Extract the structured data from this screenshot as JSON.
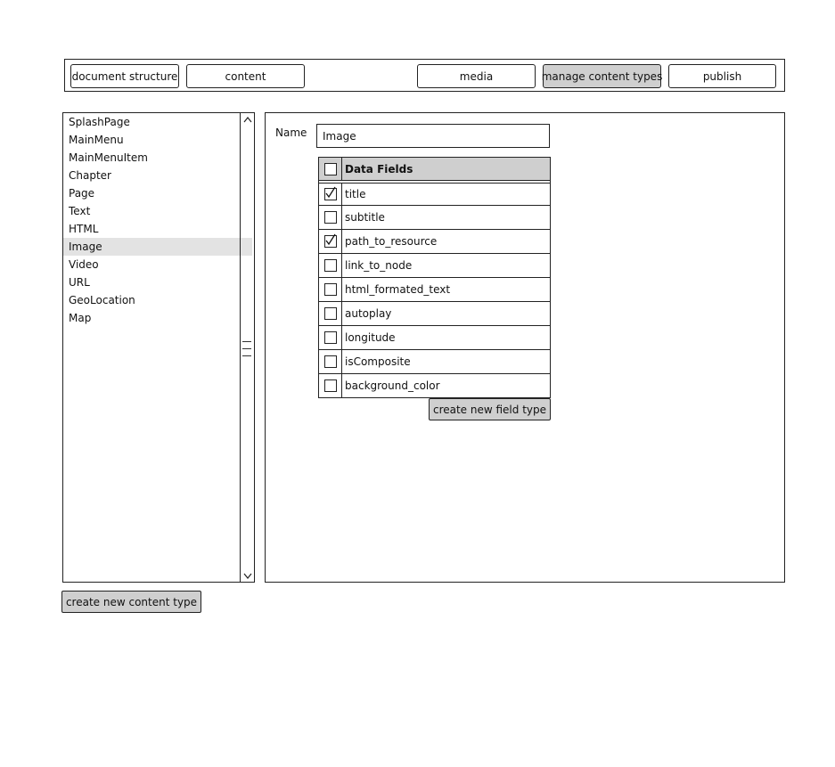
{
  "tabs": [
    {
      "label": "document structure",
      "active": false
    },
    {
      "label": "content",
      "active": false
    },
    {
      "label": "media",
      "active": false
    },
    {
      "label": "manage content types",
      "active": true
    },
    {
      "label": "publish",
      "active": false
    }
  ],
  "content_types": {
    "items": [
      "SplashPage",
      "MainMenu",
      "MainMenuItem",
      "Chapter",
      "Page",
      "Text",
      "HTML",
      "Image",
      "Video",
      "URL",
      "GeoLocation",
      "Map"
    ],
    "selected": "Image"
  },
  "detail": {
    "name_label": "Name",
    "name_value": "Image",
    "fields_header": "Data Fields",
    "fields": [
      {
        "label": "title",
        "checked": true
      },
      {
        "label": "subtitle",
        "checked": false
      },
      {
        "label": "path_to_resource",
        "checked": true
      },
      {
        "label": "link_to_node",
        "checked": false
      },
      {
        "label": "html_formated_text",
        "checked": false
      },
      {
        "label": "autoplay",
        "checked": false
      },
      {
        "label": "longitude",
        "checked": false
      },
      {
        "label": "isComposite",
        "checked": false
      },
      {
        "label": "background_color",
        "checked": false
      }
    ],
    "create_field_label": "create new field type"
  },
  "create_type_label": "create new content type",
  "icons": {
    "scroll_up": "chevron-up-icon",
    "scroll_down": "chevron-down-icon",
    "check": "checkmark-icon"
  },
  "colors": {
    "active_tab": "#cfcfcf",
    "selected_row": "#e3e3e3",
    "header_row": "#cfcfcf"
  }
}
